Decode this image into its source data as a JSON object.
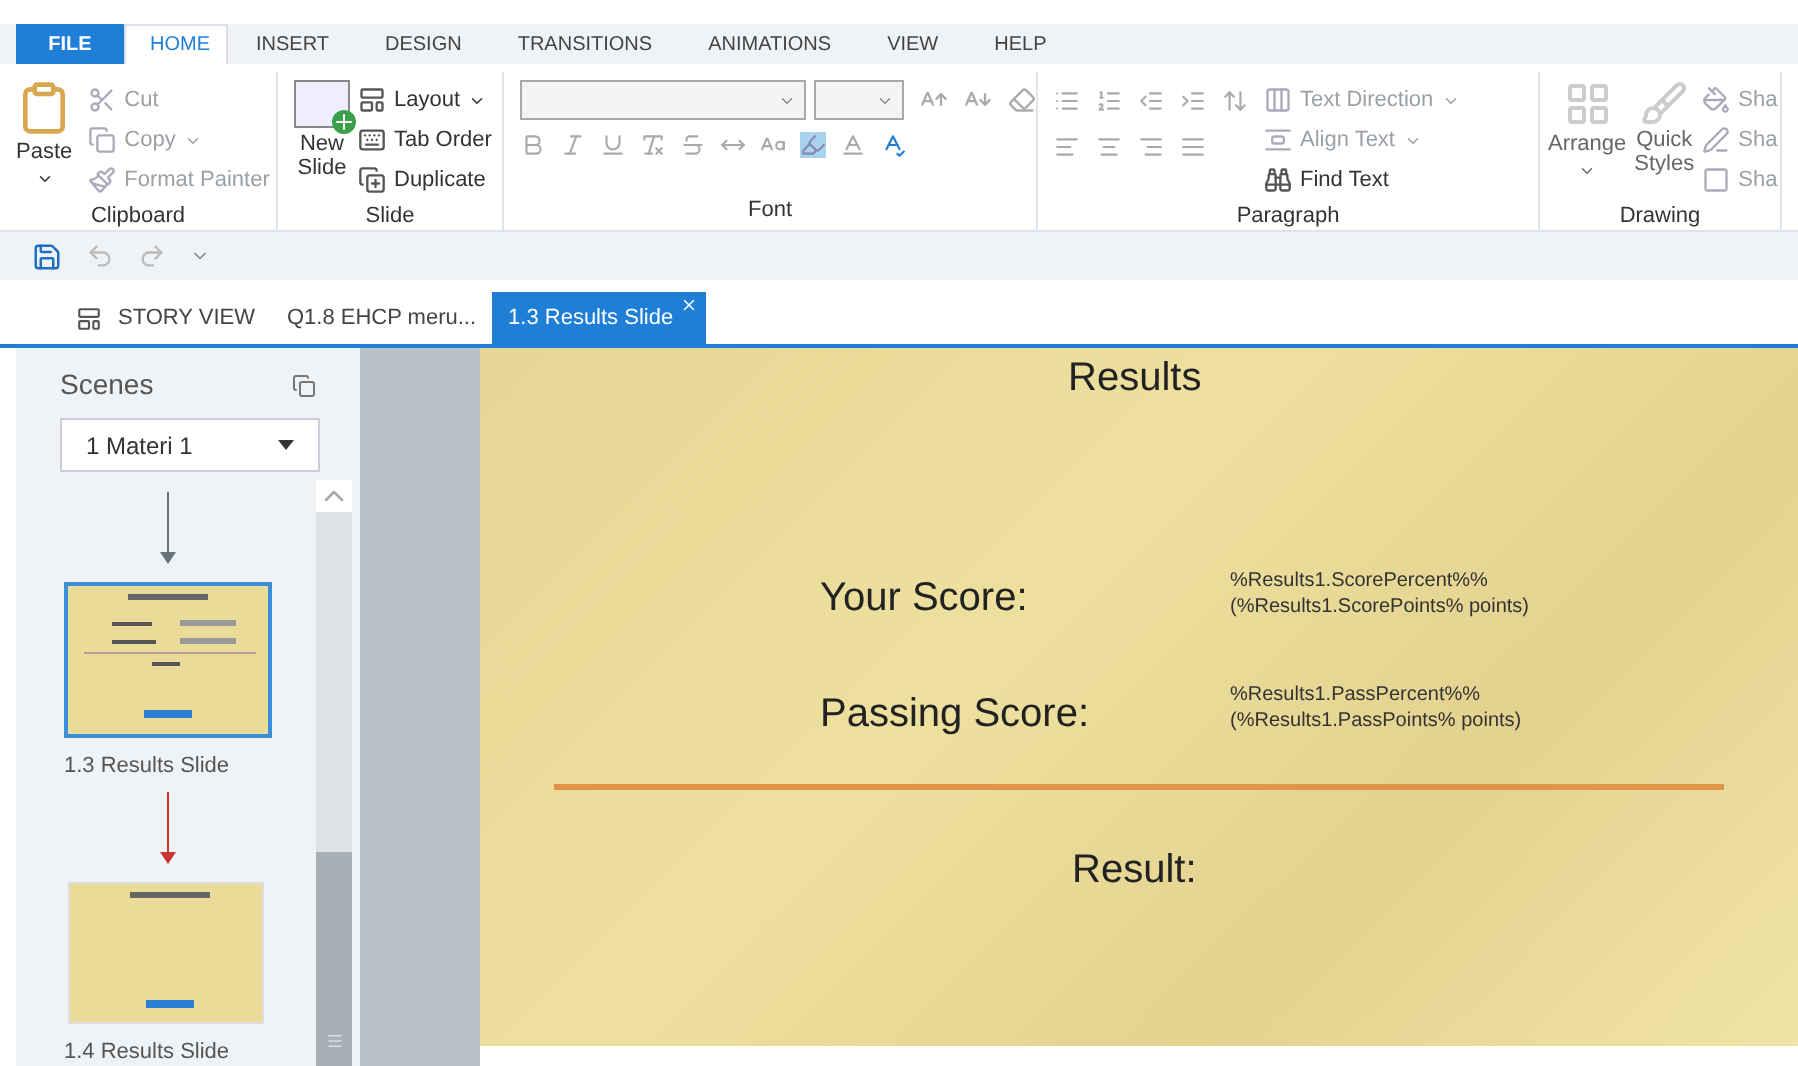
{
  "ribbon_tabs": [
    {
      "label": "FILE",
      "kind": "file",
      "selected": false
    },
    {
      "label": "HOME",
      "kind": "tab",
      "selected": true
    },
    {
      "label": "INSERT",
      "kind": "tab",
      "selected": false
    },
    {
      "label": "DESIGN",
      "kind": "tab",
      "selected": false
    },
    {
      "label": "TRANSITIONS",
      "kind": "tab",
      "selected": false
    },
    {
      "label": "ANIMATIONS",
      "kind": "tab",
      "selected": false
    },
    {
      "label": "VIEW",
      "kind": "tab",
      "selected": false
    },
    {
      "label": "HELP",
      "kind": "tab",
      "selected": false
    }
  ],
  "clipboard": {
    "title": "Clipboard",
    "paste": "Paste",
    "items": [
      "Cut",
      "Copy",
      "Format Painter"
    ]
  },
  "slide_group": {
    "title": "Slide",
    "new_slide": [
      "New",
      "Slide"
    ],
    "items": [
      "Layout",
      "Tab Order",
      "Duplicate"
    ]
  },
  "font_group": {
    "title": "Font"
  },
  "paragraph_group": {
    "title": "Paragraph",
    "items": [
      "Text Direction",
      "Align Text",
      "Find Text"
    ]
  },
  "drawing_group": {
    "title": "Drawing",
    "arrange": "Arrange",
    "quick_styles": [
      "Quick",
      "Styles"
    ],
    "items": [
      "Sha",
      "Sha",
      "Sha"
    ]
  },
  "doc_tabs": [
    {
      "label": "STORY VIEW",
      "kind": "story",
      "selected": false
    },
    {
      "label": "Q1.8 EHCP meru...",
      "kind": "slide",
      "selected": false
    },
    {
      "label": "1.3 Results Slide",
      "kind": "slide",
      "selected": true
    }
  ],
  "scenes": {
    "title": "Scenes",
    "dropdown": "1 Materi 1",
    "slides": [
      {
        "label": "1.3 Results Slide",
        "selected": true
      },
      {
        "label": "1.4 Results Slide",
        "selected": false
      }
    ]
  },
  "slide": {
    "title": "Results",
    "rows": [
      {
        "label": "Your Score:",
        "value": [
          "%Results1.ScorePercent%%",
          "(%Results1.ScorePoints% points)"
        ]
      },
      {
        "label": "Passing Score:",
        "value": [
          "%Results1.PassPercent%%",
          "(%Results1.PassPoints% points)"
        ]
      }
    ],
    "result": "Result:"
  }
}
